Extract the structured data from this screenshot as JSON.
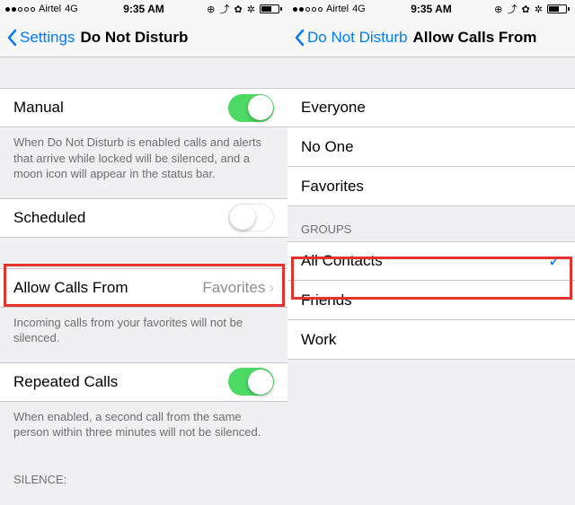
{
  "status": {
    "carrier": "Airtel",
    "net": "4G",
    "time": "9:35 AM"
  },
  "left": {
    "back": "Settings",
    "title": "Do Not Disturb",
    "manual": {
      "label": "Manual",
      "on": true
    },
    "manual_footer": "When Do Not Disturb is enabled calls and alerts that arrive while locked will be silenced, and a moon icon will appear in the status bar.",
    "scheduled": {
      "label": "Scheduled",
      "on": false
    },
    "allow": {
      "label": "Allow Calls From",
      "value": "Favorites"
    },
    "allow_footer": "Incoming calls from your favorites will not be silenced.",
    "repeated": {
      "label": "Repeated Calls",
      "on": true
    },
    "repeated_footer": "When enabled, a second call from the same person within three minutes will not be silenced.",
    "silence_header": "SILENCE:"
  },
  "right": {
    "back": "Do Not Disturb",
    "title": "Allow Calls From",
    "rows": [
      "Everyone",
      "No One",
      "Favorites"
    ],
    "groups_header": "GROUPS",
    "groups": [
      "All Contacts",
      "Friends",
      "Work"
    ],
    "selected": "All Contacts"
  }
}
